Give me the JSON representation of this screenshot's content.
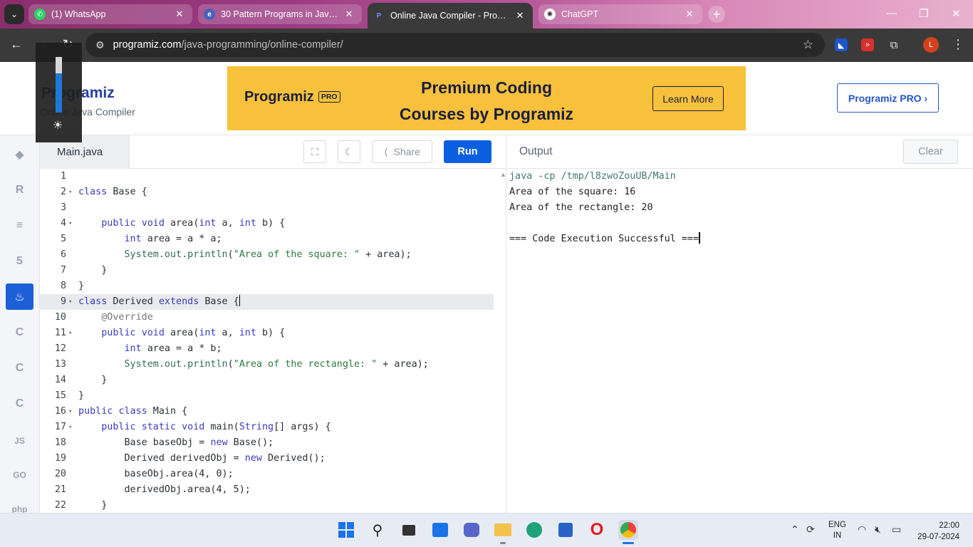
{
  "browser": {
    "tabs": [
      {
        "label": "(1) WhatsApp",
        "icon": "whatsapp-icon",
        "active": false
      },
      {
        "label": "30 Pattern Programs in Java: Sta",
        "icon": "site-icon",
        "active": false
      },
      {
        "label": "Online Java Compiler - Program",
        "icon": "programiz-icon",
        "active": true
      },
      {
        "label": "ChatGPT",
        "icon": "chatgpt-icon",
        "active": false
      }
    ],
    "url_host": "programiz.com",
    "url_path": "/java-programming/online-compiler/",
    "profile_initial": "L"
  },
  "site": {
    "logo_text": "rogramiz",
    "logo_p": "P",
    "subtitle": "Online Java Compiler",
    "promo": {
      "logo_text": "rogramiz",
      "logo_p": "P",
      "badge": "PRO",
      "headline_1": "Premium Coding",
      "headline_2": "Courses by Programiz",
      "cta": "Learn More"
    },
    "pro_button": "Programiz PRO ›"
  },
  "sidebar": {
    "items": [
      {
        "name": "python",
        "glyph": "◆"
      },
      {
        "name": "r",
        "glyph": "R"
      },
      {
        "name": "sql",
        "glyph": "≡"
      },
      {
        "name": "html",
        "glyph": "5"
      },
      {
        "name": "java",
        "glyph": "♨",
        "active": true
      },
      {
        "name": "c",
        "glyph": "C"
      },
      {
        "name": "cpp",
        "glyph": "C"
      },
      {
        "name": "csharp",
        "glyph": "C"
      },
      {
        "name": "js",
        "glyph": "JS"
      },
      {
        "name": "go",
        "glyph": "GO"
      },
      {
        "name": "php",
        "glyph": "php"
      }
    ]
  },
  "editor": {
    "file_name": "Main.java",
    "share_label": "Share",
    "run_label": "Run",
    "lines": [
      {
        "n": "1",
        "fold": "",
        "code": ""
      },
      {
        "n": "2",
        "fold": "▾",
        "code": "class Base {"
      },
      {
        "n": "3",
        "fold": "",
        "code": ""
      },
      {
        "n": "4",
        "fold": "▾",
        "code": "    public void area(int a, int b) {"
      },
      {
        "n": "5",
        "fold": "",
        "code": "        int area = a * a;"
      },
      {
        "n": "6",
        "fold": "",
        "code": "        System.out.println(\"Area of the square: \" + area);"
      },
      {
        "n": "7",
        "fold": "",
        "code": "    }"
      },
      {
        "n": "8",
        "fold": "",
        "code": "}"
      },
      {
        "n": "9",
        "fold": "▾",
        "code": "class Derived extends Base {",
        "highlight": true
      },
      {
        "n": "10",
        "fold": "",
        "code": "    @Override"
      },
      {
        "n": "11",
        "fold": "▾",
        "code": "    public void area(int a, int b) {"
      },
      {
        "n": "12",
        "fold": "",
        "code": "        int area = a * b;"
      },
      {
        "n": "13",
        "fold": "",
        "code": "        System.out.println(\"Area of the rectangle: \" + area);"
      },
      {
        "n": "14",
        "fold": "",
        "code": "    }"
      },
      {
        "n": "15",
        "fold": "",
        "code": "}"
      },
      {
        "n": "16",
        "fold": "▾",
        "code": "public class Main {"
      },
      {
        "n": "17",
        "fold": "▾",
        "code": "    public static void main(String[] args) {"
      },
      {
        "n": "18",
        "fold": "",
        "code": "        Base baseObj = new Base();"
      },
      {
        "n": "19",
        "fold": "",
        "code": "        Derived derivedObj = new Derived();"
      },
      {
        "n": "20",
        "fold": "",
        "code": "        baseObj.area(4, 0);"
      },
      {
        "n": "21",
        "fold": "",
        "code": "        derivedObj.area(4, 5);"
      },
      {
        "n": "22",
        "fold": "",
        "code": "    }"
      }
    ]
  },
  "output": {
    "title": "Output",
    "clear_label": "Clear",
    "lines": [
      {
        "text": "java -cp /tmp/l8zwoZouUB/Main",
        "cmd": true
      },
      {
        "text": "Area of the square: 16"
      },
      {
        "text": "Area of the rectangle: 20"
      },
      {
        "text": ""
      },
      {
        "text": "=== Code Execution Successful ==="
      }
    ]
  },
  "overlay": {
    "brightness_level": 0.7
  },
  "taskbar": {
    "lang_1": "ENG",
    "lang_2": "IN",
    "time": "22:00",
    "date": "29-07-2024"
  },
  "colors": {
    "run": "#0a5fde",
    "promo_bg": "#f8c13b",
    "active_lang": "#1d5fd6"
  }
}
